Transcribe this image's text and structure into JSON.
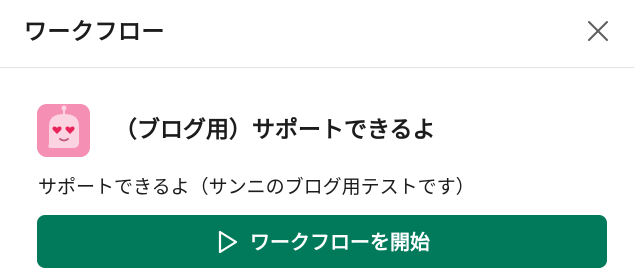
{
  "header": {
    "title": "ワークフロー",
    "close_icon": "close-icon"
  },
  "app": {
    "name": "（ブログ用）サポートできるよ",
    "icon": "robot-heart-eyes-icon",
    "description": "サポートできるよ（サンニのブログ用テストです）"
  },
  "actions": {
    "start_label": "ワークフローを開始",
    "start_icon": "play-icon"
  },
  "colors": {
    "primary_button": "#007a5a",
    "app_icon_background": "#f590b4",
    "text": "#1d1c1d",
    "divider": "#e2e2e2"
  }
}
